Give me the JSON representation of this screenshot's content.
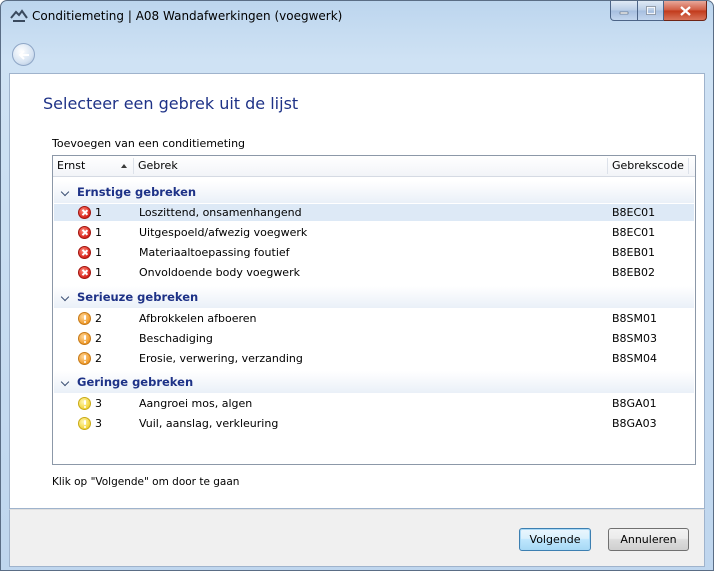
{
  "window": {
    "title": "Conditiemeting | A08 Wandafwerkingen (voegwerk)"
  },
  "page": {
    "heading": "Selecteer een gebrek uit de lijst",
    "subtitle": "Toevoegen van een conditiemeting",
    "hint": "Klik op \"Volgende\" om door te gaan"
  },
  "columns": {
    "ernst": "Ernst",
    "gebrek": "Gebrek",
    "code": "Gebrekscode"
  },
  "groups": [
    {
      "label": "Ernstige gebreken",
      "icon": "severity-red-x-icon",
      "rows": [
        {
          "ernst": "1",
          "gebrek": "Loszittend, onsamenhangend",
          "code": "B8EC01"
        },
        {
          "ernst": "1",
          "gebrek": "Uitgespoeld/afwezig voegwerk",
          "code": "B8EC01"
        },
        {
          "ernst": "1",
          "gebrek": "Materiaaltoepassing foutief",
          "code": "B8EB01"
        },
        {
          "ernst": "1",
          "gebrek": "Onvoldoende body voegwerk",
          "code": "B8EB02"
        }
      ]
    },
    {
      "label": "Serieuze gebreken",
      "icon": "severity-orange-warning-icon",
      "rows": [
        {
          "ernst": "2",
          "gebrek": "Afbrokkelen afboeren",
          "code": "B8SM01"
        },
        {
          "ernst": "2",
          "gebrek": "Beschadiging",
          "code": "B8SM03"
        },
        {
          "ernst": "2",
          "gebrek": "Erosie, verwering, verzanding",
          "code": "B8SM04"
        }
      ]
    },
    {
      "label": "Geringe gebreken",
      "icon": "severity-yellow-warning-icon",
      "rows": [
        {
          "ernst": "3",
          "gebrek": "Aangroei mos, algen",
          "code": "B8GA01"
        },
        {
          "ernst": "3",
          "gebrek": "Vuil, aanslag, verkleuring",
          "code": "B8GA03"
        }
      ]
    }
  ],
  "buttons": {
    "next": "Volgende",
    "cancel": "Annuleren"
  },
  "colors": {
    "heading": "#1e3287",
    "selected_row": "#dde9f6",
    "red": "#d8231c",
    "orange": "#ef9a2b",
    "yellow": "#f2d43a"
  }
}
